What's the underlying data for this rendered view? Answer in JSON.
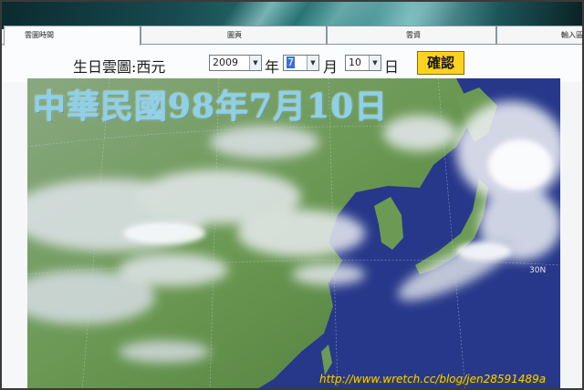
{
  "tabs": [
    {
      "label": "雲圖時間"
    },
    {
      "label": "圖頁"
    },
    {
      "label": "雲資"
    },
    {
      "label": "輸入區"
    }
  ],
  "form": {
    "prefix": "生日雲圖:西元",
    "year_value": "2009",
    "year_suffix": "年",
    "month_value": "7",
    "month_suffix": "月",
    "day_value": "10",
    "day_suffix": "日",
    "confirm_label": "確認"
  },
  "map": {
    "title": "中華民國98年7月10日",
    "latitude_label": "30N"
  },
  "watermark": "http://www.wretch.cc/blog/jen28591489a",
  "colors": {
    "ocean": "#2a3c8f",
    "land": "#5e8a4a",
    "cloud": "#eef1f5",
    "confirm_button": "#ffd21f",
    "title_text": "#8fd0e6",
    "watermark_text": "#f0d01c"
  }
}
